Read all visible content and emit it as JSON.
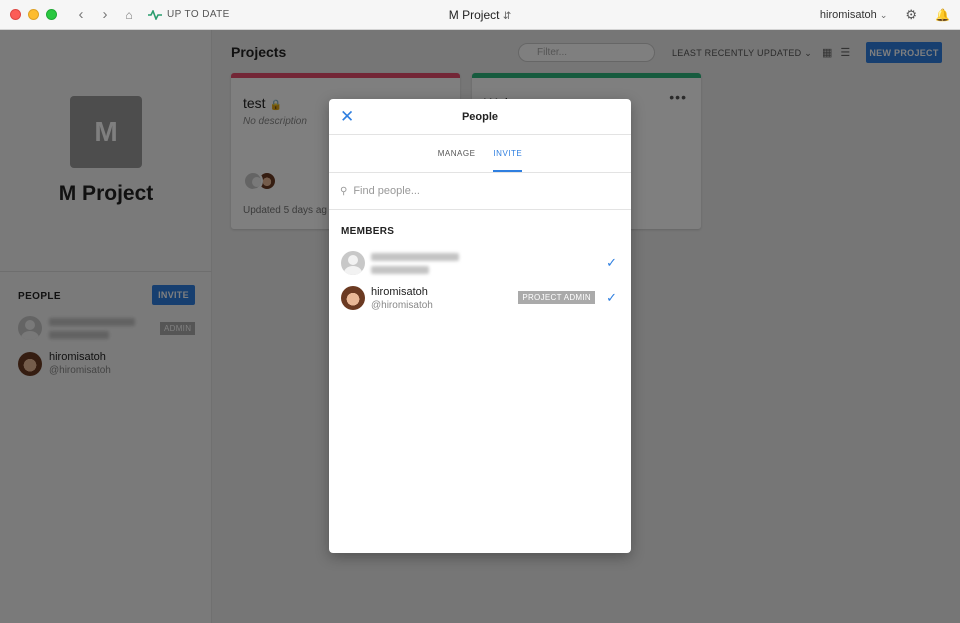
{
  "titlebar": {
    "status_label": "UP TO DATE",
    "project_name": "M Project",
    "user_menu": "hiromisatoh"
  },
  "sidebar": {
    "project_initial": "M",
    "project_name": "M Project",
    "people_title": "PEOPLE",
    "invite_label": "INVITE",
    "members": [
      {
        "name": "",
        "handle": "",
        "badge": "ADMIN",
        "avatar": "generic"
      },
      {
        "name": "hiromisatoh",
        "handle": "@hiromisatoh",
        "avatar": "photo"
      }
    ]
  },
  "main": {
    "title": "Projects",
    "filter_placeholder": "Filter...",
    "sort_label": "LEAST RECENTLY UPDATED",
    "new_project_label": "NEW PROJECT",
    "cards": [
      {
        "title": "test",
        "description": "No description",
        "updated": "Updated 5 days ag",
        "color": "#e74c6c"
      },
      {
        "title": "Wel",
        "description": "",
        "updated": "",
        "color": "#2cb67d"
      }
    ]
  },
  "modal": {
    "title": "People",
    "tabs": [
      {
        "label": "MANAGE"
      },
      {
        "label": "INVITE"
      }
    ],
    "active_tab": "INVITE",
    "search_placeholder": "Find people...",
    "members_title": "MEMBERS",
    "members": [
      {
        "name": "",
        "handle": "",
        "badge": "",
        "avatar": "generic"
      },
      {
        "name": "hiromisatoh",
        "handle": "@hiromisatoh",
        "badge": "PROJECT ADMIN",
        "avatar": "photo"
      }
    ]
  },
  "colors": {
    "accent": "#2f7fe0",
    "status_green": "#2a9d6e"
  }
}
